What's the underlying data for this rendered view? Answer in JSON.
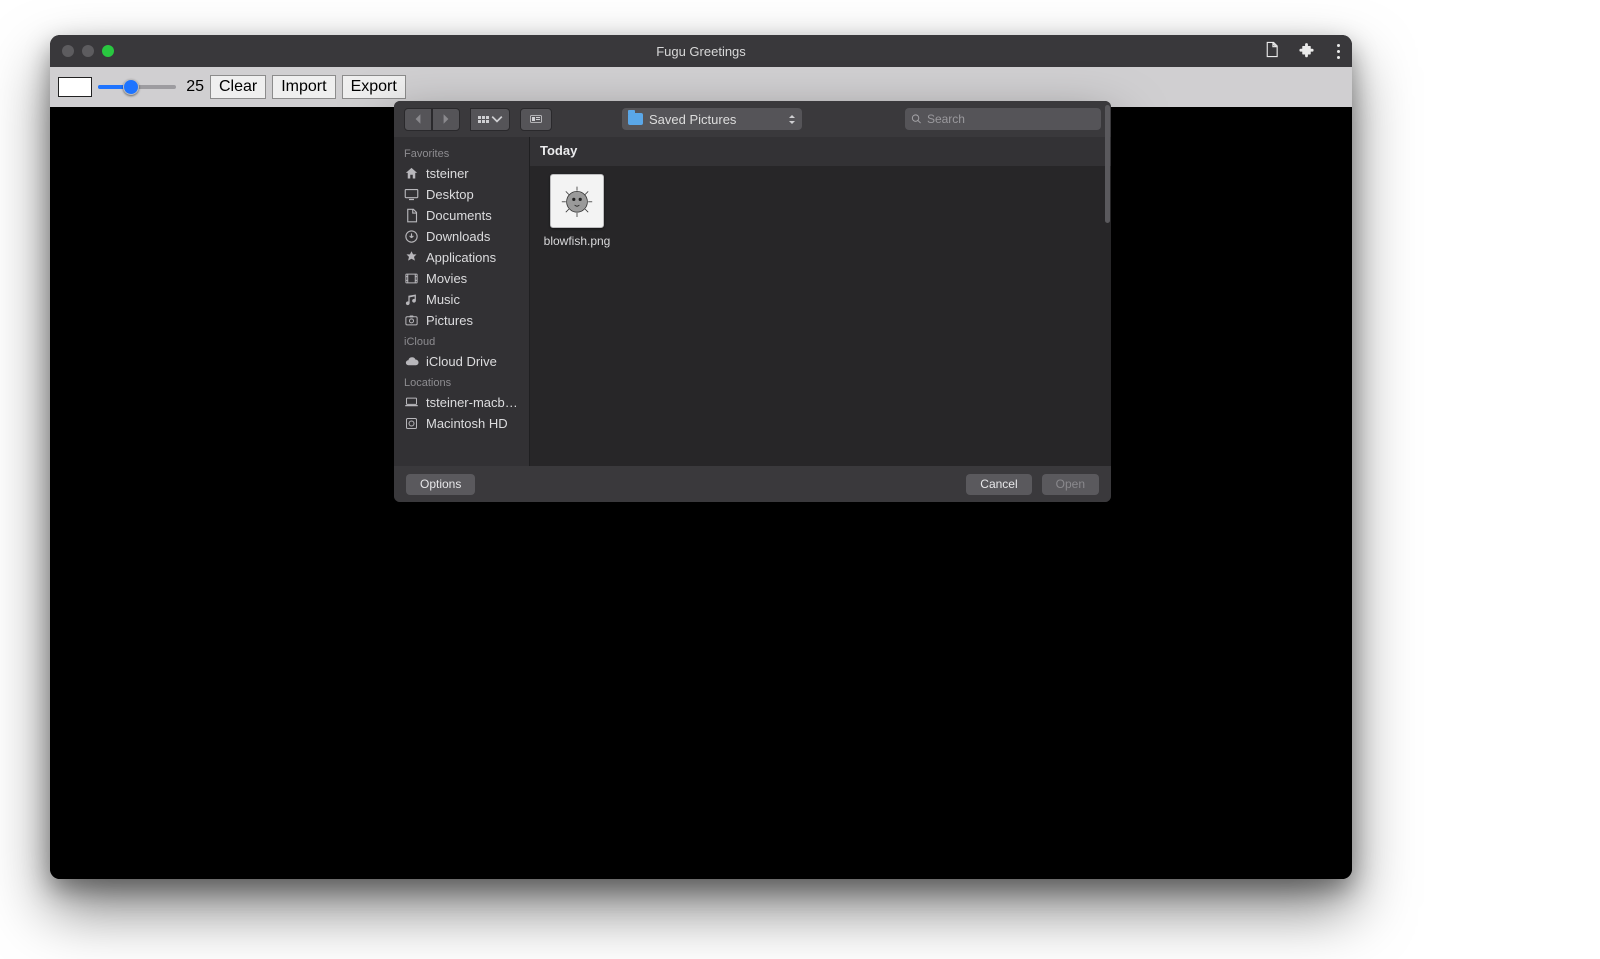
{
  "window": {
    "title": "Fugu Greetings"
  },
  "toolbar": {
    "slider_value": "25",
    "clear": "Clear",
    "import": "Import",
    "export": "Export"
  },
  "picker": {
    "path_label": "Saved Pictures",
    "search_placeholder": "Search",
    "group_header": "Today",
    "files": [
      {
        "name": "blowfish.png"
      }
    ],
    "sidebar": {
      "sections": [
        {
          "header": "Favorites",
          "items": [
            {
              "icon": "home",
              "label": "tsteiner"
            },
            {
              "icon": "desktop",
              "label": "Desktop"
            },
            {
              "icon": "doc",
              "label": "Documents"
            },
            {
              "icon": "download",
              "label": "Downloads"
            },
            {
              "icon": "apps",
              "label": "Applications"
            },
            {
              "icon": "movie",
              "label": "Movies"
            },
            {
              "icon": "music",
              "label": "Music"
            },
            {
              "icon": "photo",
              "label": "Pictures"
            }
          ]
        },
        {
          "header": "iCloud",
          "items": [
            {
              "icon": "cloud",
              "label": "iCloud Drive"
            }
          ]
        },
        {
          "header": "Locations",
          "items": [
            {
              "icon": "laptop",
              "label": "tsteiner-macb…"
            },
            {
              "icon": "disk",
              "label": "Macintosh HD"
            }
          ]
        }
      ]
    },
    "buttons": {
      "options": "Options",
      "cancel": "Cancel",
      "open": "Open"
    }
  }
}
